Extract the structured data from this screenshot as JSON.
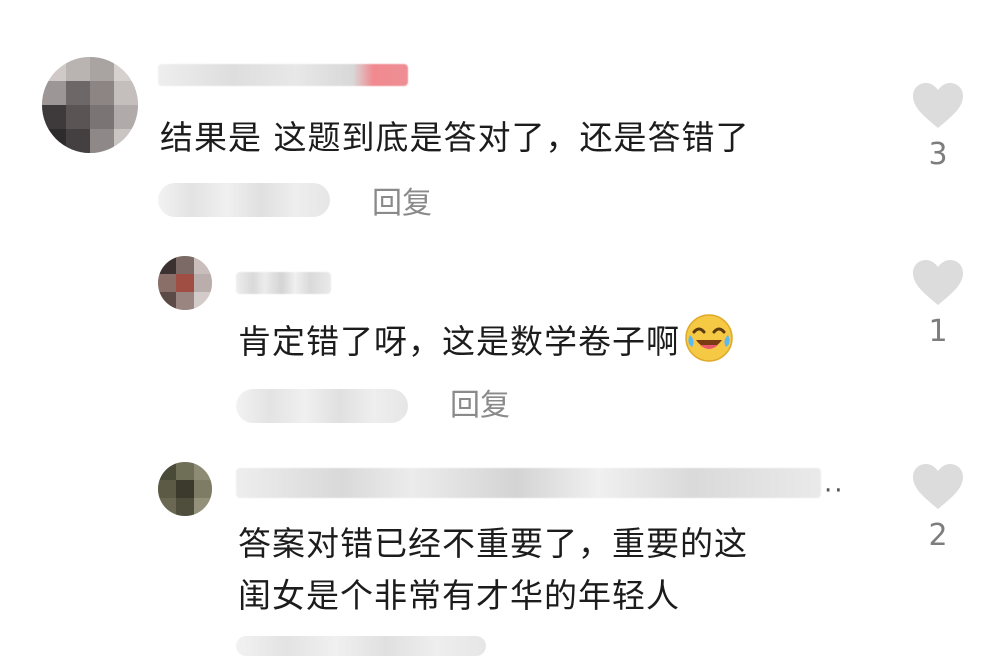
{
  "comments": [
    {
      "text": "结果是 这题到底是答对了，还是答错了",
      "reply_label": "回复",
      "like_count": "3"
    },
    {
      "text": "肯定错了呀，这是数学卷子啊",
      "emoji_icon": "laugh-cry-emoji-icon",
      "reply_label": "回复",
      "like_count": "1"
    },
    {
      "text_line1": "答案对错已经不重要了，重要的这",
      "text_line2": "闺女是个非常有才华的年轻人",
      "like_count": "2"
    }
  ],
  "colors": {
    "text": "#1c1c1c",
    "muted": "#8a8a8a",
    "heart": "#dcdcdc"
  }
}
